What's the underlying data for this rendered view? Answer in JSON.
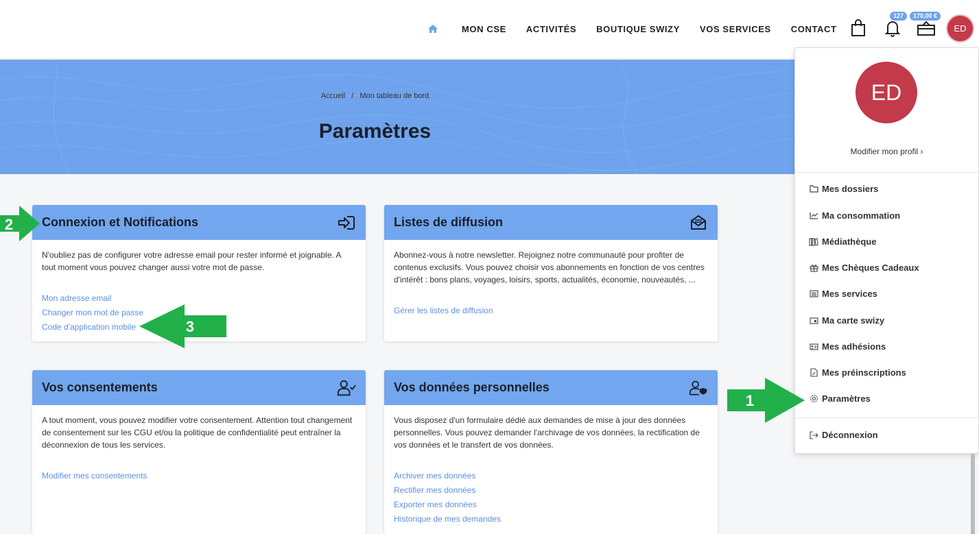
{
  "nav": {
    "items": [
      "MON CSE",
      "ACTIVITÉS",
      "BOUTIQUE SWIZY",
      "VOS SERVICES",
      "CONTACT"
    ],
    "notifications_badge": "127",
    "wallet_badge": "170,00 €",
    "avatar_initials": "ED"
  },
  "hero": {
    "breadcrumb": [
      "Accueil",
      "Mon tableau de bord"
    ],
    "breadcrumb_sep": "/",
    "title": "Paramètres"
  },
  "cards": [
    {
      "title": "Connexion et Notifications",
      "icon": "login-icon",
      "text": "N'oubliez pas de configurer votre adresse email pour rester informé et joignable. A tout moment vous pouvez changer aussi votre mot de passe.",
      "links": [
        "Mon adresse email",
        "Changer mon mot de passe",
        "Code d'application mobile"
      ]
    },
    {
      "title": "Listes de diffusion",
      "icon": "mail-open-icon",
      "text": "Abonnez-vous à notre newsletter. Rejoignez notre communauté pour profiter de contenus exclusifs. Vous pouvez choisir vos abonnements en fonction de vos centres d'intérêt : bons plans, voyages, loisirs, sports, actualités, économie, nouveautés, ...",
      "links": [
        "Gérer les listes de diffusion"
      ]
    },
    {
      "title": "Vos consentements",
      "icon": "user-check-icon",
      "text": "A tout moment, vous pouvez modifier votre consentement. Attention tout changement de consentement sur les CGU et/ou la politique de confidentialité peut entraîner la déconnexion de tous les services.",
      "links": [
        "Modifier mes consentements"
      ]
    },
    {
      "title": "Vos données personnelles",
      "icon": "user-shield-icon",
      "text": "Vous disposez d'un formulaire dédié aux demandes de mise à jour des données personnelles. Vous pouvez demander l'archivage de vos données, la rectification de vos données et le transfert de vos données.",
      "links": [
        "Archiver mes données",
        "Rectifier mes données",
        "Exporter mes données",
        "Historique de mes demandes"
      ]
    }
  ],
  "dropdown": {
    "avatar_initials": "ED",
    "edit_profile": "Modifier mon profil ›",
    "items": [
      {
        "label": "Mes dossiers",
        "icon": "folder-icon"
      },
      {
        "label": "Ma consommation",
        "icon": "chart-line-icon"
      },
      {
        "label": "Médiathèque",
        "icon": "library-icon"
      },
      {
        "label": "Mes Chèques Cadeaux",
        "icon": "gift-icon"
      },
      {
        "label": "Mes services",
        "icon": "list-icon"
      },
      {
        "label": "Ma carte swizy",
        "icon": "card-icon"
      },
      {
        "label": "Mes adhésions",
        "icon": "id-card-icon"
      },
      {
        "label": "Mes préinscriptions",
        "icon": "document-edit-icon"
      },
      {
        "label": "Paramètres",
        "icon": "gear-icon"
      }
    ],
    "logout": {
      "label": "Déconnexion",
      "icon": "logout-icon"
    }
  },
  "annotations": [
    "1",
    "2",
    "3"
  ],
  "colors": {
    "accent": "#6fa3ed",
    "avatar": "#c33a4a",
    "arrow": "#22b04b",
    "link": "#5b8fe0"
  }
}
